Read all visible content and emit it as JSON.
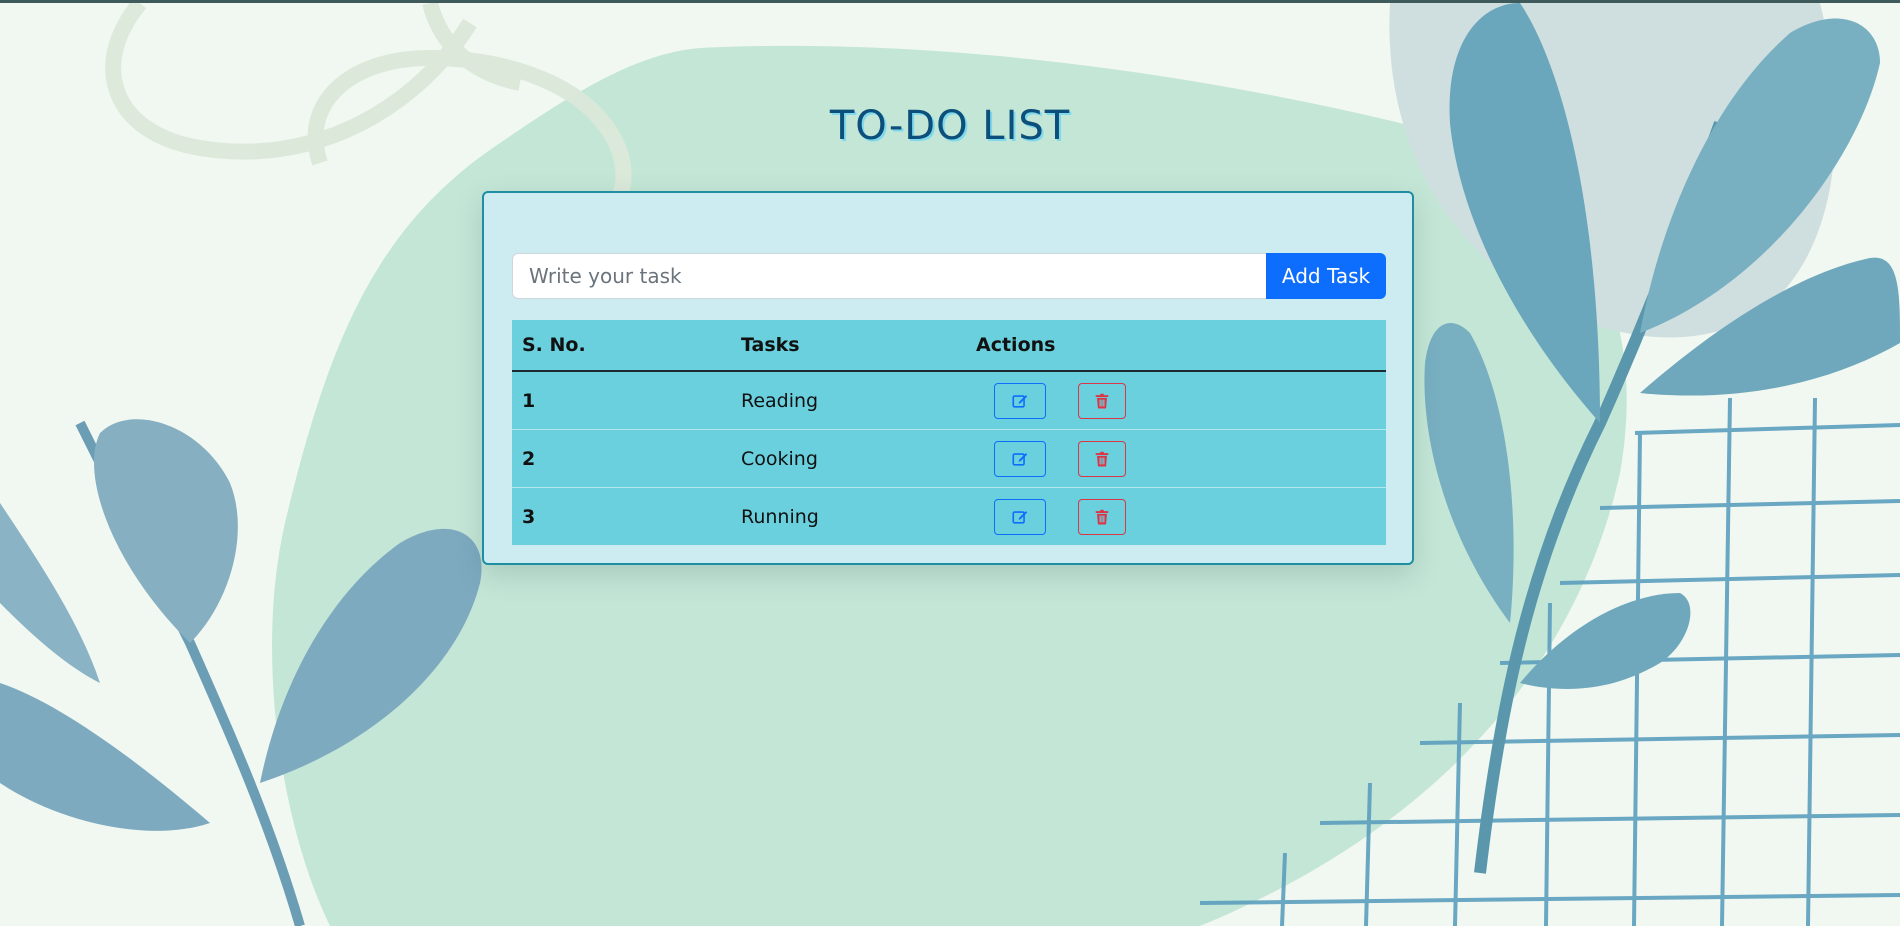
{
  "page": {
    "title": "TO-DO LIST"
  },
  "form": {
    "input_placeholder": "Write your task",
    "input_value": "",
    "add_button_label": "Add Task"
  },
  "table": {
    "headers": {
      "sno": "S. No.",
      "task": "Tasks",
      "actions": "Actions"
    },
    "rows": [
      {
        "sno": "1",
        "task": "Reading"
      },
      {
        "sno": "2",
        "task": "Cooking"
      },
      {
        "sno": "3",
        "task": "Running"
      }
    ]
  },
  "icons": {
    "edit": "edit-icon",
    "delete": "trash-icon"
  },
  "colors": {
    "title": "#0b4f7a",
    "card_background": "#cdecf2",
    "card_border": "#1f8ea2",
    "table_background": "#6ad0de",
    "primary": "#0d6efd",
    "danger": "#dc3545"
  }
}
